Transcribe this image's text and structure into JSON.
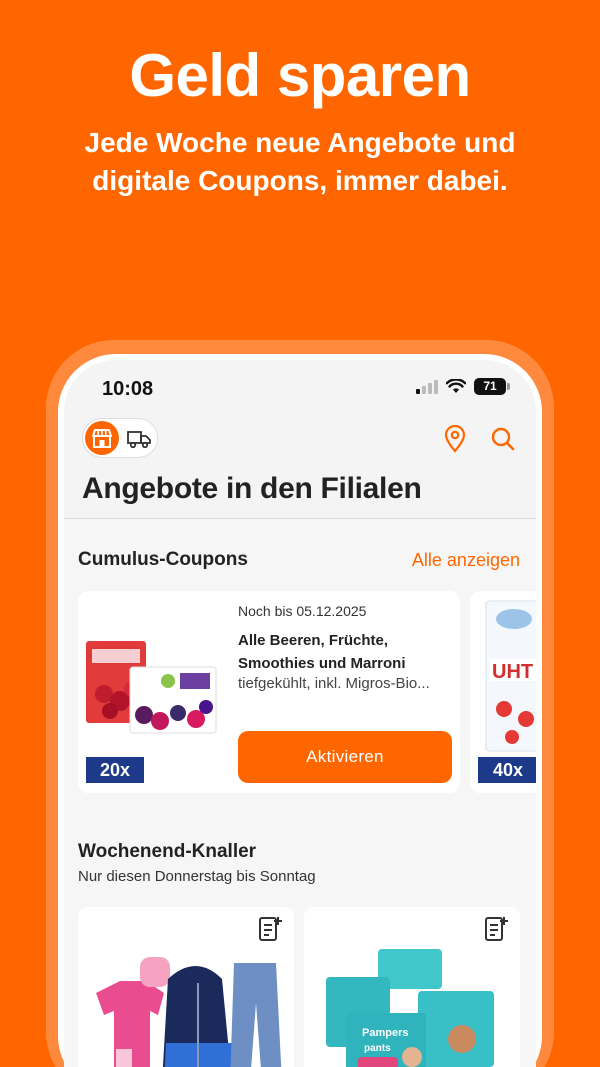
{
  "promo": {
    "headline": "Geld sparen",
    "subline": "Jede Woche neue Angebote und digitale Coupons, immer dabei."
  },
  "status_bar": {
    "time": "10:08",
    "battery": "71"
  },
  "header": {
    "store_mode_icon": "store-icon",
    "delivery_mode_icon": "truck-icon",
    "location_icon": "location-pin-icon",
    "search_icon": "search-icon",
    "title": "Angebote in den Filialen"
  },
  "coupons": {
    "title": "Cumulus-Coupons",
    "show_all": "Alle anzeigen",
    "items": [
      {
        "valid_until": "Noch bis 05.12.2025",
        "name": "Alle Beeren, Früchte, Smoothies und Marroni",
        "description": "tiefgekühlt, inkl. Migros-Bio...",
        "multiplier": "20x",
        "button": "Aktivieren"
      },
      {
        "multiplier": "40x",
        "product_text": "UHT"
      }
    ]
  },
  "weekend": {
    "title": "Wochenend-Knaller",
    "subtitle": "Nur diesen Donnerstag bis Sonntag",
    "add_to_list_icon": "add-to-list-icon",
    "products": [
      {
        "name": "clothing",
        "image_icon": "kids-clothing-icon"
      },
      {
        "name": "pampers",
        "brand": "Pampers",
        "variant": "pants",
        "image_icon": "diapers-icon"
      }
    ]
  },
  "colors": {
    "brand_orange": "#FF6600",
    "badge_blue": "#1d3a8a"
  }
}
